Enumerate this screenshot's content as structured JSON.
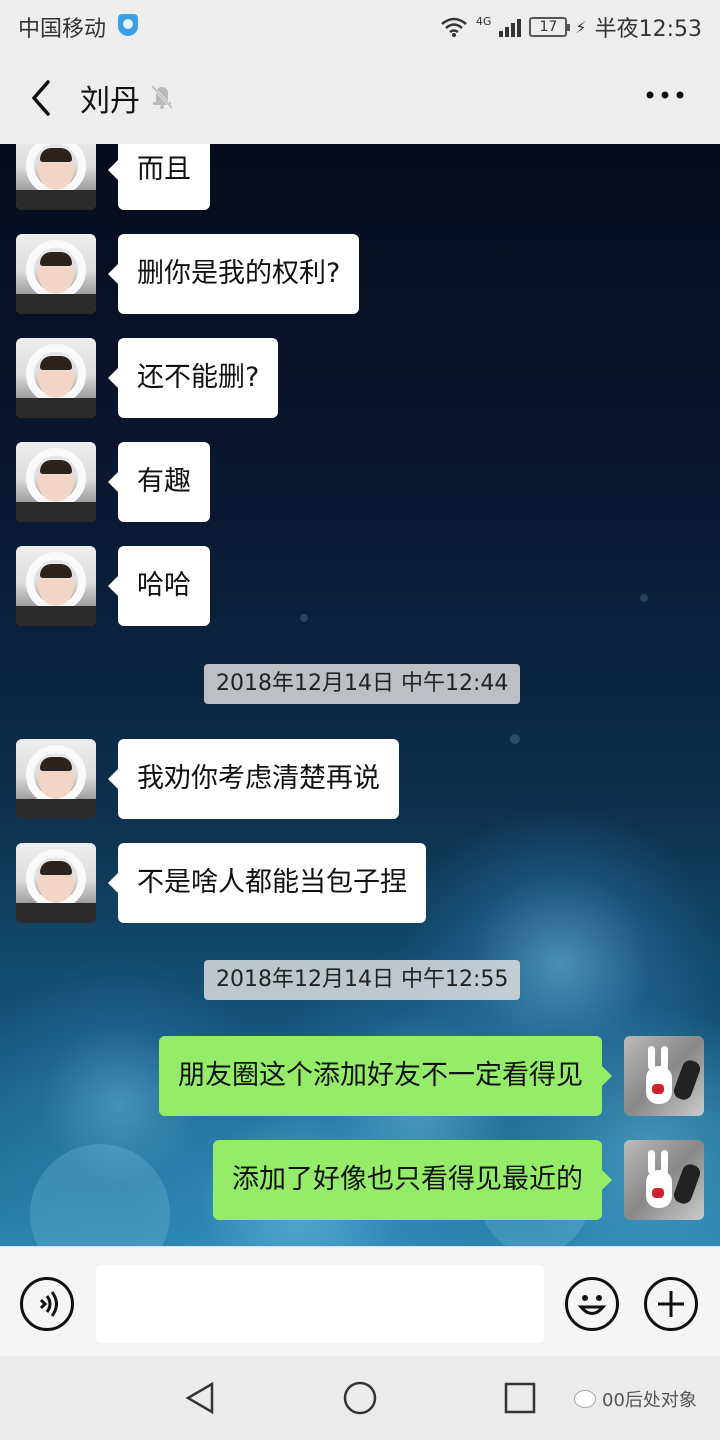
{
  "status_bar": {
    "carrier": "中国移动",
    "network": "4G",
    "battery": "17",
    "time": "半夜12:53"
  },
  "header": {
    "title": "刘丹",
    "back_icon": "chevron-left-icon",
    "mute_icon": "bell-off-icon",
    "more_icon": "more-dots-icon"
  },
  "messages": [
    {
      "side": "in",
      "text": "而且"
    },
    {
      "side": "in",
      "text": "删你是我的权利?"
    },
    {
      "side": "in",
      "text": "还不能删?"
    },
    {
      "side": "in",
      "text": "有趣"
    },
    {
      "side": "in",
      "text": "哈哈"
    },
    {
      "type": "time",
      "text": "2018年12月14日 中午12:44"
    },
    {
      "side": "in",
      "text": "我劝你考虑清楚再说"
    },
    {
      "side": "in",
      "text": "不是啥人都能当包子捏"
    },
    {
      "type": "time",
      "text": "2018年12月14日 中午12:55"
    },
    {
      "side": "out",
      "text": "朋友圈这个添加好友不一定看得见"
    },
    {
      "side": "out",
      "text": "添加了好像也只看得见最近的"
    }
  ],
  "input_bar": {
    "voice_icon": "voice-icon",
    "input_value": "",
    "emoji_icon": "emoji-icon",
    "plus_icon": "plus-icon"
  },
  "nav_bar": {
    "back_icon": "nav-back-icon",
    "home_icon": "nav-home-icon",
    "recent_icon": "nav-recent-icon",
    "watermark": "00后处对象"
  },
  "colors": {
    "incoming_bubble": "#ffffff",
    "outgoing_bubble": "#95ec69",
    "header_bg": "#ededed"
  }
}
